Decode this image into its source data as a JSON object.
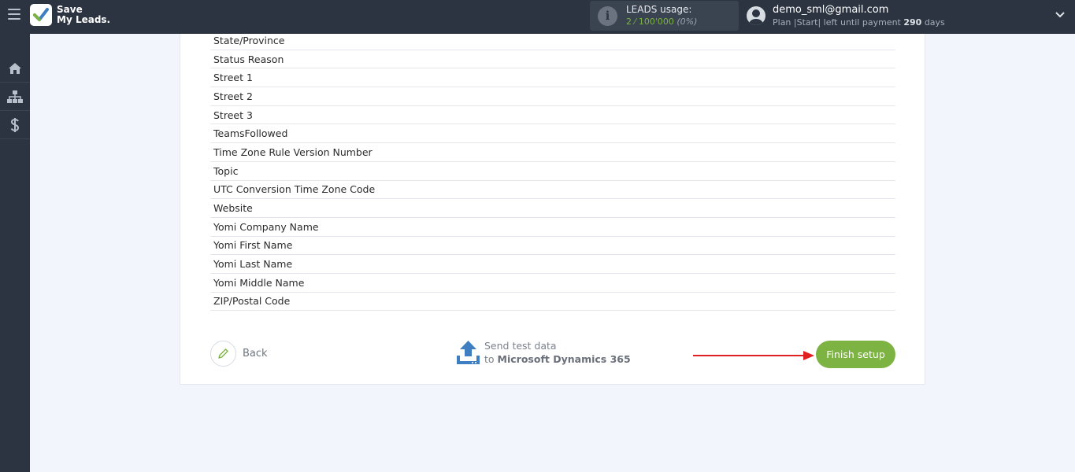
{
  "header": {
    "logo_line1": "Save",
    "logo_line2": "My Leads.",
    "usage_label": "LEADS usage:",
    "usage_count": "2 ⁄ 100'000",
    "usage_percent": "(0%)",
    "email": "demo_sml@gmail.com",
    "plan_prefix": "Plan |Start| left until payment",
    "plan_days": "290",
    "plan_suffix": "days"
  },
  "sidebar": {
    "items": [
      {
        "icon": "home-icon"
      },
      {
        "icon": "sitemap-icon"
      },
      {
        "icon": "dollar-icon"
      }
    ]
  },
  "fields": [
    "State/Province",
    "Status Reason",
    "Street 1",
    "Street 2",
    "Street 3",
    "TeamsFollowed",
    "Time Zone Rule Version Number",
    "Topic",
    "UTC Conversion Time Zone Code",
    "Website",
    "Yomi Company Name",
    "Yomi First Name",
    "Yomi Last Name",
    "Yomi Middle Name",
    "ZIP/Postal Code"
  ],
  "footer": {
    "back_label": "Back",
    "send_line1": "Send test data",
    "send_line2_prefix": "to",
    "send_line2_target": "Microsoft Dynamics 365",
    "finish_label": "Finish setup"
  },
  "colors": {
    "accent_green": "#7cb342",
    "topbar": "#2c3441",
    "arrow_red": "#e02020",
    "upload_blue": "#3f7fc1"
  }
}
